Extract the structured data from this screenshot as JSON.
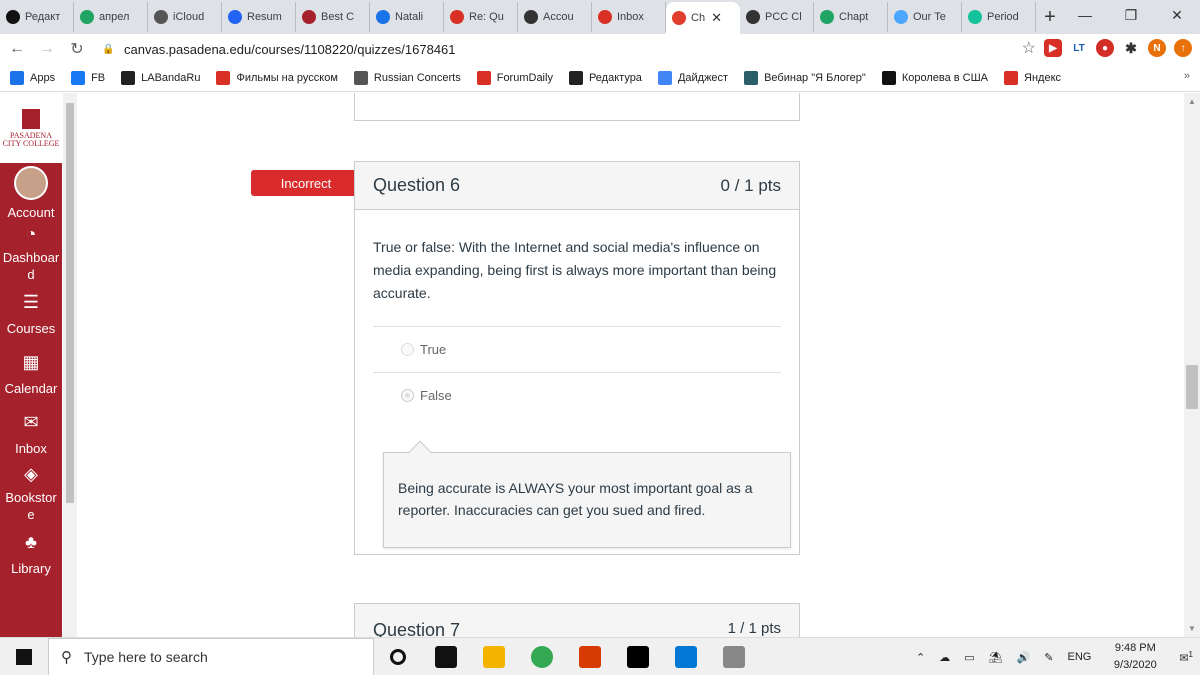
{
  "browser": {
    "tabs": [
      {
        "label": "Редакт",
        "icon": "plus-doc-icon",
        "color": "#111111"
      },
      {
        "label": "апрел",
        "icon": "drive-icon",
        "color": "#1fa463"
      },
      {
        "label": "iCloud",
        "icon": "apple-icon",
        "color": "#555555"
      },
      {
        "label": "Resum",
        "icon": "indeed-icon",
        "color": "#2164f3"
      },
      {
        "label": "Best C",
        "icon": "wp-icon",
        "color": "#a5212b"
      },
      {
        "label": "Natali",
        "icon": "diamond-icon",
        "color": "#1a73e8"
      },
      {
        "label": "Re: Qu",
        "icon": "gmail-icon",
        "color": "#d93025"
      },
      {
        "label": "Accou",
        "icon": "github-icon",
        "color": "#333333"
      },
      {
        "label": "Inbox",
        "icon": "gmail-icon",
        "color": "#d93025"
      },
      {
        "label": "Ch",
        "icon": "canvas-icon",
        "color": "#e23e2d",
        "active": true
      },
      {
        "label": "PCC Cl",
        "icon": "github-icon",
        "color": "#333333"
      },
      {
        "label": "Chapt",
        "icon": "drive-icon",
        "color": "#1fa463"
      },
      {
        "label": "Our Te",
        "icon": "wave-icon",
        "color": "#4da6ff"
      },
      {
        "label": "Period",
        "icon": "grammarly-icon",
        "color": "#15c39a"
      }
    ],
    "url": "canvas.pasadena.edu/courses/1108220/quizzes/1678461",
    "bookmarks": [
      {
        "label": "Apps",
        "icon": "apps-grid-icon",
        "color": "#1a73e8"
      },
      {
        "label": "FB",
        "icon": "facebook-icon",
        "color": "#1877f2"
      },
      {
        "label": "LABandaRu",
        "icon": "lb-icon",
        "color": "#222222"
      },
      {
        "label": "Фильмы на русском",
        "icon": "leaf-icon",
        "color": "#d93025"
      },
      {
        "label": "Russian Concerts",
        "icon": "globe-icon",
        "color": "#555555"
      },
      {
        "label": "ForumDaily",
        "icon": "forumdaily-icon",
        "color": "#d93025"
      },
      {
        "label": "Редактура",
        "icon": "lb-icon",
        "color": "#222222"
      },
      {
        "label": "Дайджест",
        "icon": "docs-icon",
        "color": "#4285f4"
      },
      {
        "label": "Вебинар \"Я Блогер\"",
        "icon": "gc-icon",
        "color": "#2a5f6a"
      },
      {
        "label": "Королева в США",
        "icon": "plus-doc-icon",
        "color": "#111111"
      },
      {
        "label": "Яндекс",
        "icon": "yandex-icon",
        "color": "#d93025"
      }
    ],
    "more_label": "»"
  },
  "canvas_nav": {
    "logo_line1": "PASADENA",
    "logo_line2": "CITY COLLEGE",
    "items": [
      {
        "label": "Account",
        "icon": "avatar-icon"
      },
      {
        "label": "Dashboard",
        "icon": "dashboard-icon"
      },
      {
        "label": "Courses",
        "icon": "courses-icon"
      },
      {
        "label": "Calendar",
        "icon": "calendar-icon"
      },
      {
        "label": "Inbox",
        "icon": "inbox-icon"
      },
      {
        "label": "Bookstore",
        "icon": "bookstore-icon"
      },
      {
        "label": "Library",
        "icon": "library-icon"
      }
    ]
  },
  "quiz": {
    "question6": {
      "badge": "Incorrect",
      "title": "Question 6",
      "points": "0 / 1 pts",
      "text": "True or false: With the Internet and social media's influence on media expanding, being first is always more important than being accurate.",
      "answers": [
        {
          "label": "True",
          "selected": false
        },
        {
          "label": "False",
          "selected": true
        }
      ],
      "comment": "Being accurate is ALWAYS your most important goal as a reporter. Inaccuracies can get you sued and fired."
    },
    "question7": {
      "title": "Question 7",
      "points": "1 / 1 pts"
    }
  },
  "taskbar": {
    "search_placeholder": "Type here to search",
    "language": "ENG",
    "time": "9:48 PM",
    "date": "9/3/2020",
    "notification_count": "1",
    "apps": [
      {
        "icon": "cortana-icon",
        "color": "#111111"
      },
      {
        "icon": "task-view-icon",
        "color": "#111111"
      },
      {
        "icon": "file-explorer-icon",
        "color": "#f4b400"
      },
      {
        "icon": "chrome-icon",
        "color": "#34a853"
      },
      {
        "icon": "office-icon",
        "color": "#d83b01"
      },
      {
        "icon": "pycharm-icon",
        "color": "#000000"
      },
      {
        "icon": "vscode-icon",
        "color": "#0078d4"
      },
      {
        "icon": "image-viewer-icon",
        "color": "#888888"
      }
    ]
  },
  "colors": {
    "canvas_red": "#a5212b",
    "incorrect_red": "#d92b2b",
    "text": "#2d3b45"
  }
}
